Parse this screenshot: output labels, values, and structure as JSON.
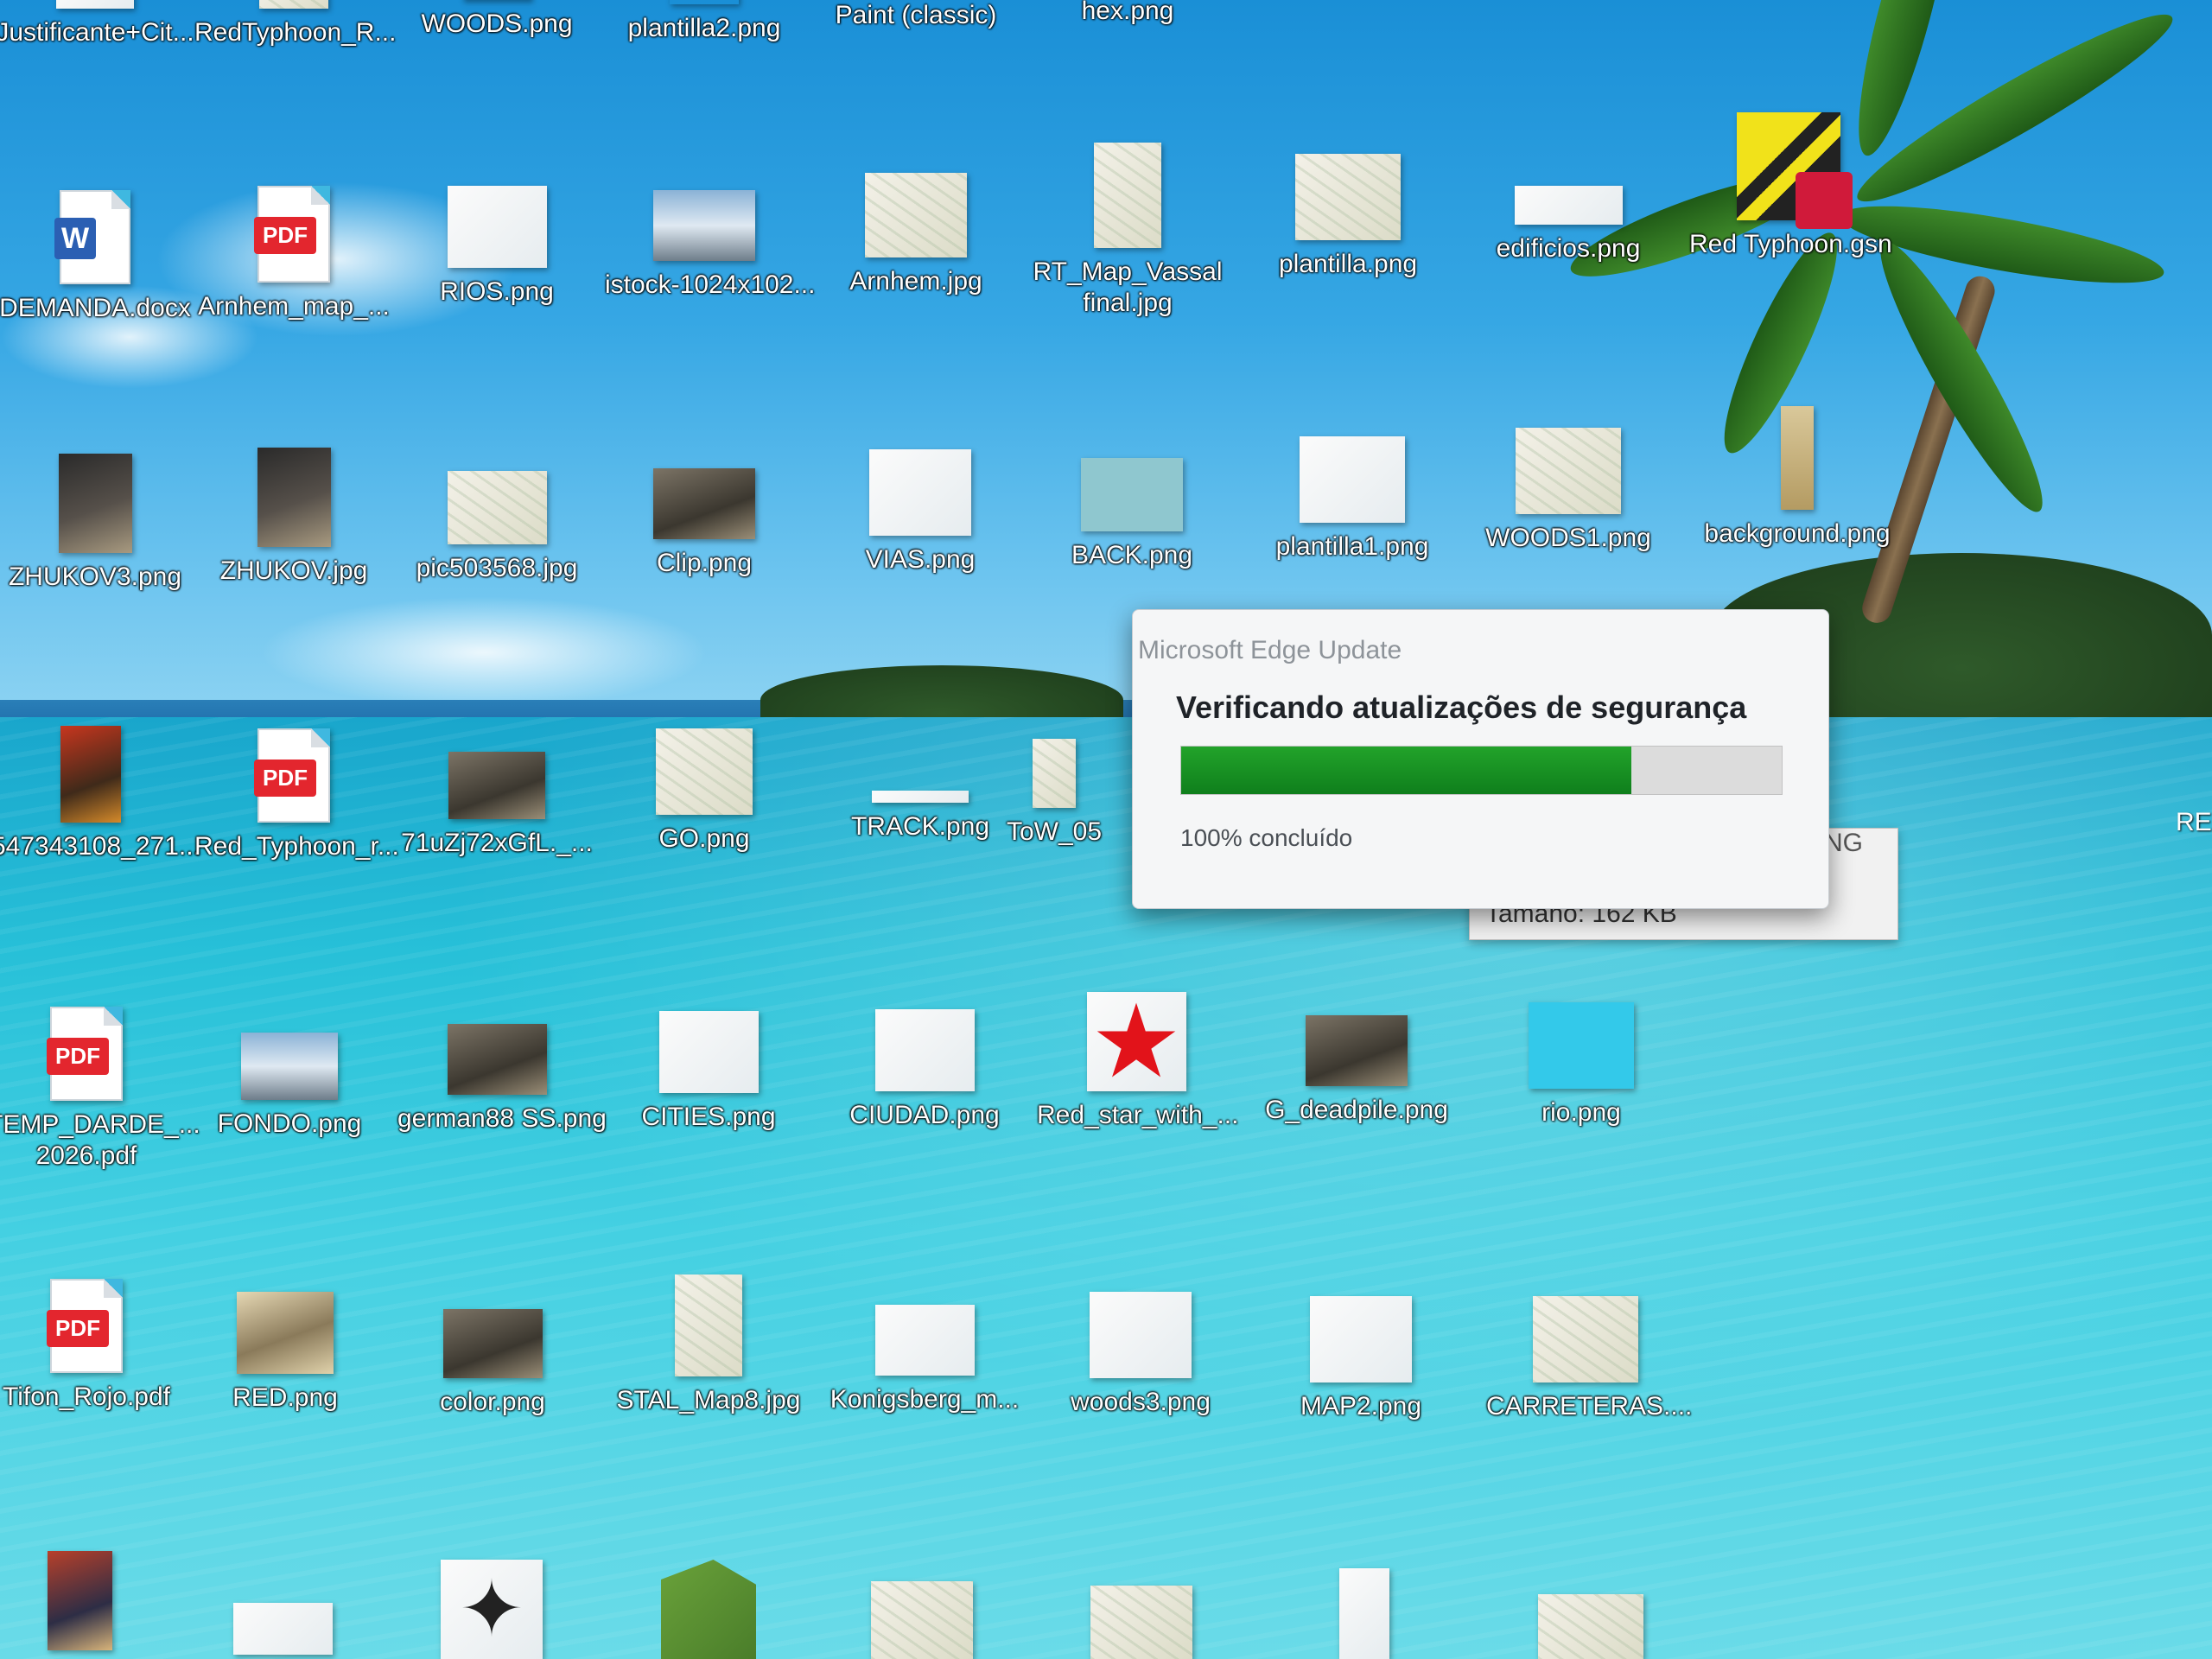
{
  "desktop": {
    "icons": [
      {
        "label": "Justificante+Cit..."
      },
      {
        "label": "RedTyphoon_R..."
      },
      {
        "label": "WOODS.png"
      },
      {
        "label": "plantilla2.png"
      },
      {
        "label": "Paint (classic)"
      },
      {
        "label": "hex.png"
      },
      {
        "label": "DEMANDA.docx"
      },
      {
        "label": "Arnhem_map_..."
      },
      {
        "label": "RIOS.png"
      },
      {
        "label": "istock-1024x102..."
      },
      {
        "label": "Arnhem.jpg"
      },
      {
        "label": "RT_Map_Vassal final.jpg"
      },
      {
        "label": "plantilla.png"
      },
      {
        "label": "edificios.png"
      },
      {
        "label": "Red Typhoon.gsn"
      },
      {
        "label": "ZHUKOV3.png"
      },
      {
        "label": "ZHUKOV.jpg"
      },
      {
        "label": "pic503568.jpg"
      },
      {
        "label": "Clip.png"
      },
      {
        "label": "VIAS.png"
      },
      {
        "label": "BACK.png"
      },
      {
        "label": "plantilla1.png"
      },
      {
        "label": "WOODS1.png"
      },
      {
        "label": "background.png"
      },
      {
        "label": "547343108_271..."
      },
      {
        "label": "Red_Typhoon_r..."
      },
      {
        "label": "71uZj72xGfL._..."
      },
      {
        "label": "GO.png"
      },
      {
        "label": "TRACK.png"
      },
      {
        "label": "ToW_05"
      },
      {
        "label": "TEMP_DARDE_... 2026.pdf"
      },
      {
        "label": "FONDO.png"
      },
      {
        "label": "german88 SS.png"
      },
      {
        "label": "CITIES.png"
      },
      {
        "label": "CIUDAD.png"
      },
      {
        "label": "Red_star_with_..."
      },
      {
        "label": "G_deadpile.png"
      },
      {
        "label": "rio.png"
      },
      {
        "label": "Tifon_Rojo.pdf"
      },
      {
        "label": "RED.png"
      },
      {
        "label": "color.png"
      },
      {
        "label": "STAL_Map8.jpg"
      },
      {
        "label": "Konigsberg_m..."
      },
      {
        "label": "woods3.png"
      },
      {
        "label": "MAP2.png"
      },
      {
        "label": "CARRETERAS...."
      }
    ],
    "edge_label": "REA"
  },
  "dialog": {
    "title": "Microsoft Edge Update",
    "heading": "Verificando atualizações de segurança",
    "progress": 0.75,
    "status": "100% concluído"
  },
  "tooltip": {
    "type_fragment": "PNG",
    "size": "Tamaño: 162 KB"
  },
  "colors": {
    "progress_fill": "#1a8f25",
    "pdf_badge": "#e3262e",
    "word_badge": "#2b5fb3"
  }
}
